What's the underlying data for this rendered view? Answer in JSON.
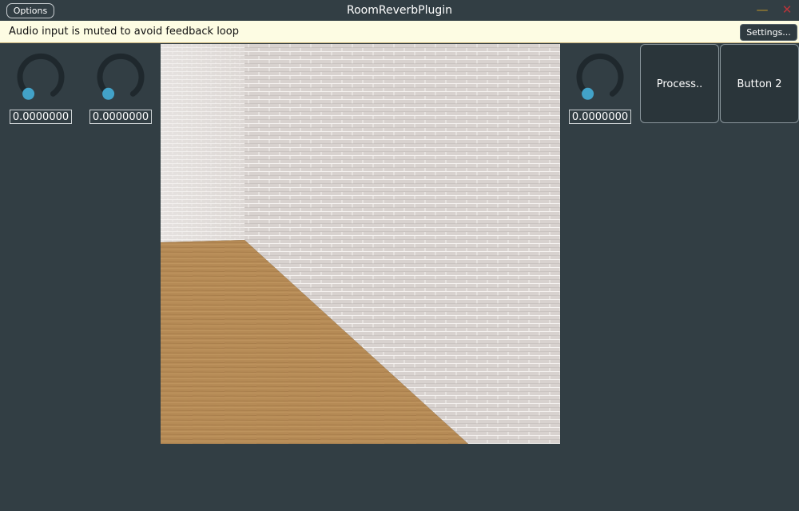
{
  "window": {
    "title": "RoomReverbPlugin",
    "options_label": "Options",
    "minimize_glyph": "—",
    "close_glyph": "✕"
  },
  "banner": {
    "message": "Audio input is muted to avoid feedback loop",
    "settings_label": "Settings..."
  },
  "knobs": [
    {
      "value_text": "0.0000000",
      "value": 0.0
    },
    {
      "value_text": "0.0000000",
      "value": 0.0
    },
    {
      "value_text": "0.0000000",
      "value": 0.0
    }
  ],
  "buttons": {
    "process_label": "Process..",
    "button2_label": "Button 2"
  },
  "colors": {
    "background": "#323e44",
    "knob_accent": "#42a2c8",
    "knob_track": "#1f282d",
    "banner": "#fdfce3",
    "brick": "#d9d3d0",
    "floor": "#b58a55"
  }
}
